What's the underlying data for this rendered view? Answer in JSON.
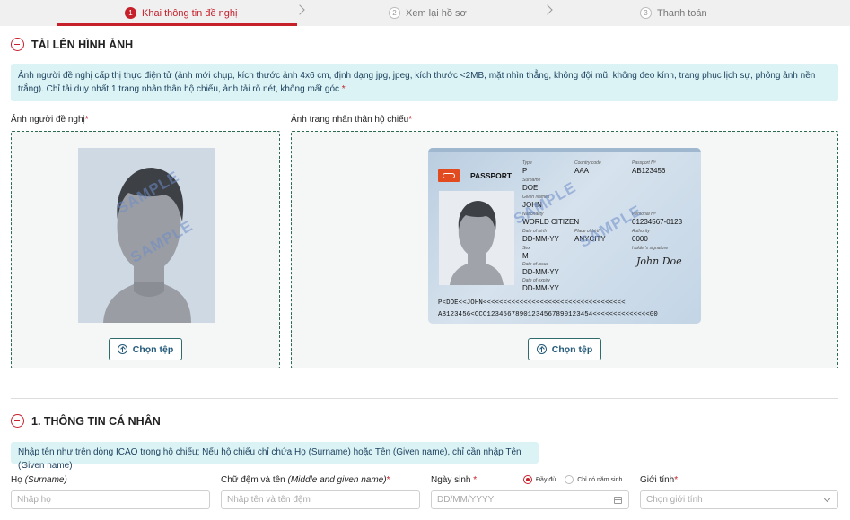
{
  "stepper": {
    "steps": [
      {
        "num": "1",
        "label": "Khai thông tin đề nghị"
      },
      {
        "num": "2",
        "label": "Xem lại hồ sơ"
      },
      {
        "num": "3",
        "label": "Thanh toán"
      }
    ],
    "active_index": 0
  },
  "upload_section": {
    "title": "TẢI LÊN HÌNH ẢNH",
    "info": "Ảnh người đề nghị cấp thị thực điện tử (ảnh mới chụp, kích thước ảnh 4x6 cm, định dạng jpg, jpeg, kích thước <2MB, mặt nhìn thẳng, không đội mũ, không đeo kính, trang phục lịch sự, phông ảnh nền trắng). Chỉ tải duy nhất 1 trang nhân thân hộ chiếu, ảnh tải rõ nét, không mất góc",
    "info_required": "*",
    "photo_label": "Ảnh người đề nghị",
    "passport_label": "Ảnh trang nhân thân hộ chiếu",
    "required_mark": "*",
    "choose_file": "Chọn tệp",
    "sample_watermark": "SAMPLE"
  },
  "passport_sample": {
    "heading": "PASSPORT",
    "type_label": "Type",
    "type": "P",
    "country_label": "Country code",
    "country": "AAA",
    "number_label": "Passport Nº",
    "number": "AB123456",
    "surname_label": "Surname",
    "surname": "DOE",
    "given_label": "Given Names",
    "given": "JOHN",
    "nationality_label": "Nationality",
    "nationality": "WORLD CITIZEN",
    "dob_label": "Date of birth",
    "dob": "DD-MM-YY",
    "id_label": "Personal Nº",
    "id": "01234567-0123",
    "pob_label": "Place of birth",
    "pob": "ANYCITY",
    "authority_label": "Authority",
    "authority": "0000",
    "sex_label": "Sex",
    "sex": "M",
    "signature_label": "Holder's signature",
    "signature": "John Doe",
    "issue_label": "Date of issue",
    "issue": "DD-MM-YY",
    "expiry_label": "Date of expiry",
    "expiry": "DD-MM-YY",
    "mrz1": "P<DOE<<JOHN<<<<<<<<<<<<<<<<<<<<<<<<<<<<<<<<<<<",
    "mrz2": "AB123456<CCC12345678901234567890123454<<<<<<<<<<<<<<00"
  },
  "personal_section": {
    "title": "1. THÔNG TIN CÁ NHÂN",
    "info": "Nhập tên như trên dòng ICAO trong hộ chiếu; Nếu hộ chiếu chỉ chứa Họ (Surname) hoặc Tên (Given name), chỉ cần nhập Tên (Given name)",
    "surname_label": "Họ",
    "surname_hint": "(Surname)",
    "surname_placeholder": "Nhập họ",
    "given_label": "Chữ đệm và tên",
    "given_hint": "(Middle and given name)",
    "given_placeholder": "Nhập tên và tên đệm",
    "dob_label": "Ngày sinh",
    "dob_placeholder": "DD/MM/YYYY",
    "dob_option_full": "Đầy đủ",
    "dob_option_year": "Chỉ có năm sinh",
    "gender_label": "Giới tính",
    "gender_placeholder": "Chọn giới tính",
    "required_mark": "*"
  },
  "colors": {
    "accent": "#c6202b",
    "info_bg": "#dcf3f5",
    "button_text": "#235a7a"
  }
}
